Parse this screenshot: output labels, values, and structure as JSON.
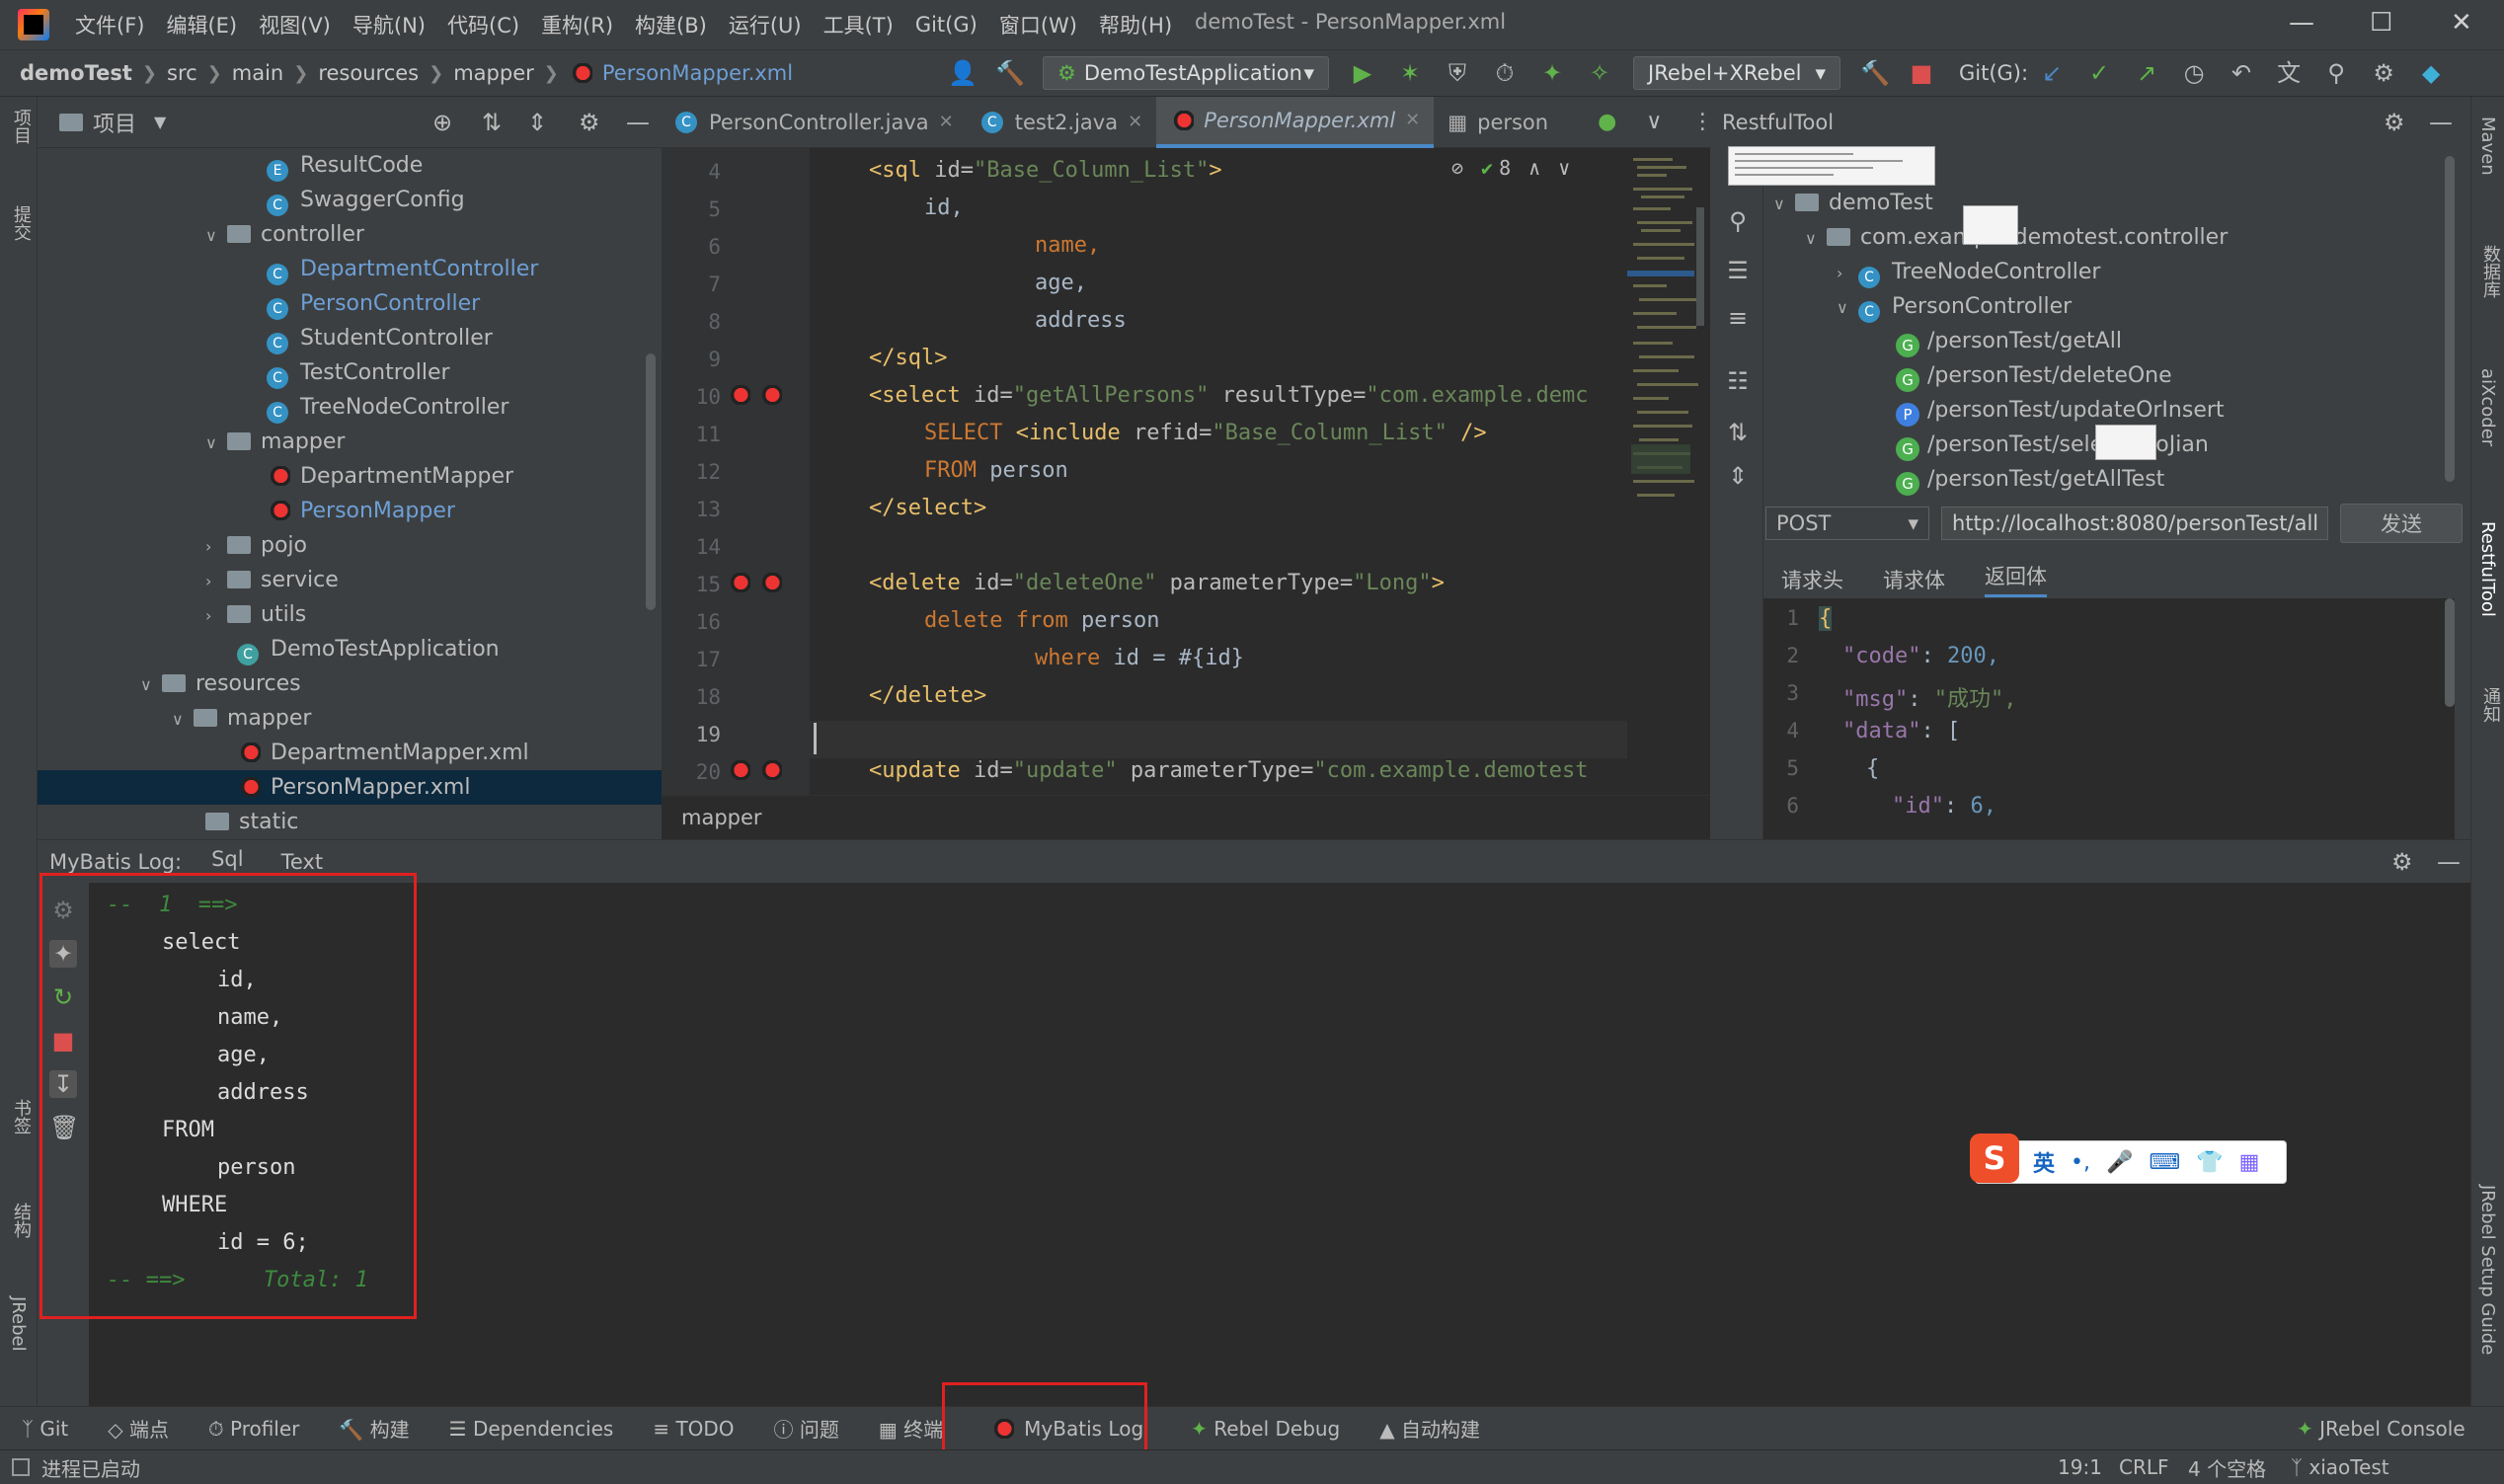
{
  "menubar": {
    "items": [
      "文件(F)",
      "编辑(E)",
      "视图(V)",
      "导航(N)",
      "代码(C)",
      "重构(R)",
      "构建(B)",
      "运行(U)",
      "工具(T)",
      "Git(G)",
      "窗口(W)",
      "帮助(H)"
    ],
    "window_title": "demoTest - PersonMapper.xml"
  },
  "navbar": {
    "breadcrumbs": [
      "demoTest",
      "src",
      "main",
      "resources",
      "mapper",
      "PersonMapper.xml"
    ],
    "run_config": "DemoTestApplication",
    "jrebel_config": "JRebel+XRebel",
    "git_label": "Git(G):"
  },
  "left_stripe": {
    "labels": [
      "项目",
      "提交",
      "书签",
      "结构",
      "JRebel"
    ]
  },
  "project": {
    "title": "项目",
    "tree": [
      {
        "label": "ResultCode",
        "icon": "enum-icon"
      },
      {
        "label": "SwaggerConfig",
        "icon": "class-icon"
      },
      {
        "label": "controller",
        "icon": "folder-icon"
      },
      {
        "label": "DepartmentController",
        "icon": "class-icon"
      },
      {
        "label": "PersonController",
        "icon": "class-icon"
      },
      {
        "label": "StudentController",
        "icon": "class-icon"
      },
      {
        "label": "TestController",
        "icon": "class-icon"
      },
      {
        "label": "TreeNodeController",
        "icon": "class-icon"
      },
      {
        "label": "mapper",
        "icon": "folder-icon"
      },
      {
        "label": "DepartmentMapper",
        "icon": "mybatis-icon"
      },
      {
        "label": "PersonMapper",
        "icon": "mybatis-icon"
      },
      {
        "label": "pojo",
        "icon": "folder-icon"
      },
      {
        "label": "service",
        "icon": "folder-icon"
      },
      {
        "label": "utils",
        "icon": "folder-icon"
      },
      {
        "label": "DemoTestApplication",
        "icon": "spring-class-icon"
      },
      {
        "label": "resources",
        "icon": "folder-icon"
      },
      {
        "label": "mapper",
        "icon": "folder-icon"
      },
      {
        "label": "DepartmentMapper.xml",
        "icon": "mybatis-icon"
      },
      {
        "label": "PersonMapper.xml",
        "icon": "mybatis-icon"
      },
      {
        "label": "static",
        "icon": "folder-icon"
      }
    ]
  },
  "editor": {
    "tabs": [
      "PersonController.java",
      "test2.java",
      "PersonMapper.xml",
      "person"
    ],
    "inspection_count": "8",
    "line_numbers": [
      "4",
      "5",
      "6",
      "7",
      "8",
      "9",
      "10",
      "11",
      "12",
      "13",
      "14",
      "15",
      "16",
      "17",
      "18",
      "19",
      "20"
    ],
    "footer": "mapper",
    "code": {
      "l4a": "<sql",
      "l4b": " id=",
      "l4c": "\"Base_Column_List\"",
      "l4d": ">",
      "l5": "id,",
      "l6": "name,",
      "l7": "age,",
      "l8": "address",
      "l9": "</sql>",
      "l10a": "<select",
      "l10b": " id=",
      "l10c": "\"getAllPersons\"",
      "l10d": " resultType=",
      "l10e": "\"com.example.demc",
      "l11a": "SELECT",
      "l11b": " <include",
      "l11c": " refid=",
      "l11d": "\"Base_Column_List\"",
      "l11e": " />",
      "l12a": "FROM",
      "l12b": " person",
      "l13": "</select>",
      "l15a": "<delete",
      "l15b": " id=",
      "l15c": "\"deleteOne\"",
      "l15d": " parameterType=",
      "l15e": "\"Long\"",
      "l15f": ">",
      "l16a": "delete",
      "l16b": " from",
      "l16c": " person",
      "l17a": "where",
      "l17b": " id = #{id}",
      "l18": "</delete>",
      "l20a": "<update",
      "l20b": " id=",
      "l20c": "\"update\"",
      "l20d": " parameterType=",
      "l20e": "\"com.example.demotest"
    }
  },
  "restful": {
    "title": "RestfulTool",
    "tree": {
      "root": "demoTest",
      "package": "com.example.demotest.controller",
      "nodes": [
        "TreeNodeController",
        "PersonController"
      ],
      "endpoints": [
        {
          "method": "G",
          "path": "/personTest/getAll"
        },
        {
          "method": "G",
          "path": "/personTest/deleteOne"
        },
        {
          "method": "P",
          "path": "/personTest/updateOrInsert"
        },
        {
          "method": "G",
          "path": "/personTest/selectTiaoJian"
        },
        {
          "method": "G",
          "path": "/personTest/getAllTest"
        }
      ]
    },
    "method": "POST",
    "url": "http://localhost:8080/personTest/all",
    "send": "发送",
    "tabs": [
      "请求头",
      "请求体",
      "返回体"
    ],
    "json_lines": [
      "1",
      "2",
      "3",
      "4",
      "5",
      "6"
    ],
    "json": {
      "l1": "{",
      "l2k": "\"code\"",
      "l2v": " 200,",
      "l3k": "\"msg\"",
      "l3v": " \"成功\",",
      "l4k": "\"data\"",
      "l4v": " [",
      "l5": "{",
      "l6k": "\"id\"",
      "l6v": " 6,"
    }
  },
  "right_stripe": {
    "labels": [
      "Maven",
      "数据库",
      "aiXcoder",
      "RestfulTool",
      "通知",
      "JRebel Setup Guide"
    ]
  },
  "mybatis_log": {
    "title": "MyBatis Log:",
    "tabs": [
      "Sql",
      "Text"
    ],
    "lines": {
      "l1": "--  1  ==>",
      "l2": "select",
      "l3": "id,",
      "l4": "name,",
      "l5": "age,",
      "l6": "address",
      "l7": "FROM",
      "l8": "person",
      "l9": "WHERE",
      "l10": "id = 6;",
      "l11": "-- ==>      Total: 1"
    }
  },
  "ime": {
    "label": "英"
  },
  "bottom_tabs": [
    "Git",
    "端点",
    "Profiler",
    "构建",
    "Dependencies",
    "TODO",
    "问题",
    "终端",
    "MyBatis Log",
    "Rebel Debug",
    "自动构建",
    "JRebel Console"
  ],
  "status": {
    "left": "进程已启动",
    "position": "19:1",
    "line_sep": "CRLF",
    "indent": "4 个空格",
    "branch": "xiaoTest"
  },
  "colors": {
    "accent": "#4a88c7",
    "highlight_box": "#e02020"
  }
}
